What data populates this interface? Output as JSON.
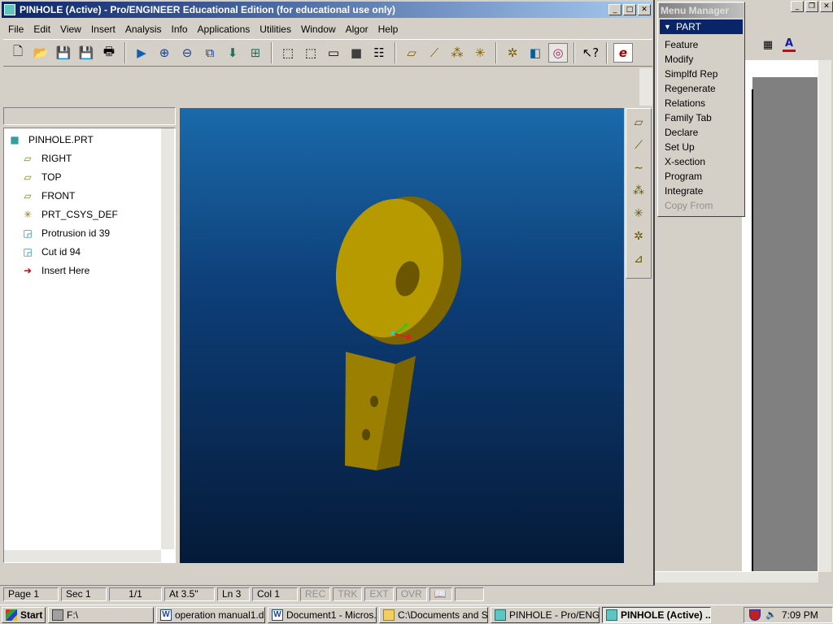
{
  "window": {
    "title": "PINHOLE (Active) - Pro/ENGINEER Educational Edition (for educational use only)"
  },
  "menus": [
    "File",
    "Edit",
    "View",
    "Insert",
    "Analysis",
    "Info",
    "Applications",
    "Utilities",
    "Window",
    "Algor",
    "Help"
  ],
  "tree": {
    "root": "PINHOLE.PRT",
    "items": [
      "RIGHT",
      "TOP",
      "FRONT",
      "PRT_CSYS_DEF",
      "Protrusion id 39",
      "Cut id 94",
      "Insert Here"
    ]
  },
  "menu_manager": {
    "title": "Menu Manager",
    "section": "PART",
    "items": [
      "Feature",
      "Modify",
      "Simplfd Rep",
      "Regenerate",
      "Relations",
      "Family Tab",
      "Declare",
      "Set Up",
      "X-section",
      "Program",
      "Integrate",
      "Copy From"
    ]
  },
  "statusbar": {
    "page": "Page 1",
    "sec": "Sec 1",
    "pages": "1/1",
    "at": "At 3.5\"",
    "ln": "Ln 3",
    "col": "Col 1",
    "rec": "REC",
    "trk": "TRK",
    "ext": "EXT",
    "ovr": "OVR"
  },
  "taskbar": {
    "start": "Start",
    "tasks": [
      "F:\\",
      "operation manual1.d...",
      "Document1 - Micros...",
      "C:\\Documents and S...",
      "PINHOLE - Pro/ENGI...",
      "PINHOLE (Active) ..."
    ],
    "clock": "7:09 PM"
  },
  "colors": {
    "titlebar": "#0a246a",
    "part_body": "#b79a00",
    "viewport_top": "#1a6aaa",
    "viewport_bottom": "#051a38"
  }
}
